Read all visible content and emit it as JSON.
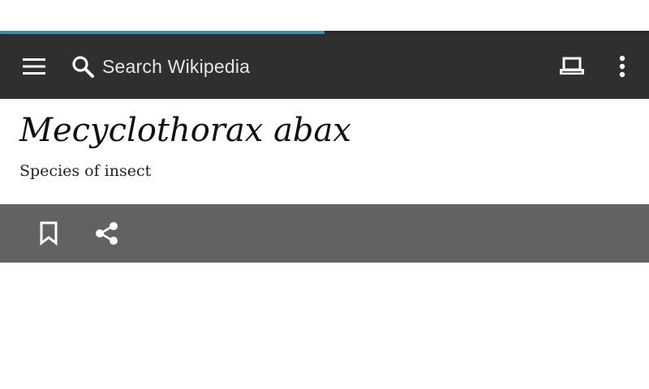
{
  "loading": {
    "progress_fraction": 0.5,
    "accent_color": "#3d8fa8"
  },
  "toolbar": {
    "menu_icon": "hamburger-menu-icon",
    "search": {
      "icon": "search-icon",
      "placeholder": "Search Wikipedia"
    },
    "tabs_icon": "tabs-icon",
    "overflow_icon": "more-vert-icon",
    "background_color": "#2f2f2f"
  },
  "article": {
    "title": "Mecyclothorax abax",
    "description": "Species of insect"
  },
  "actions": {
    "bookmark_icon": "bookmark-icon",
    "share_icon": "share-icon",
    "background_color": "#626262"
  }
}
